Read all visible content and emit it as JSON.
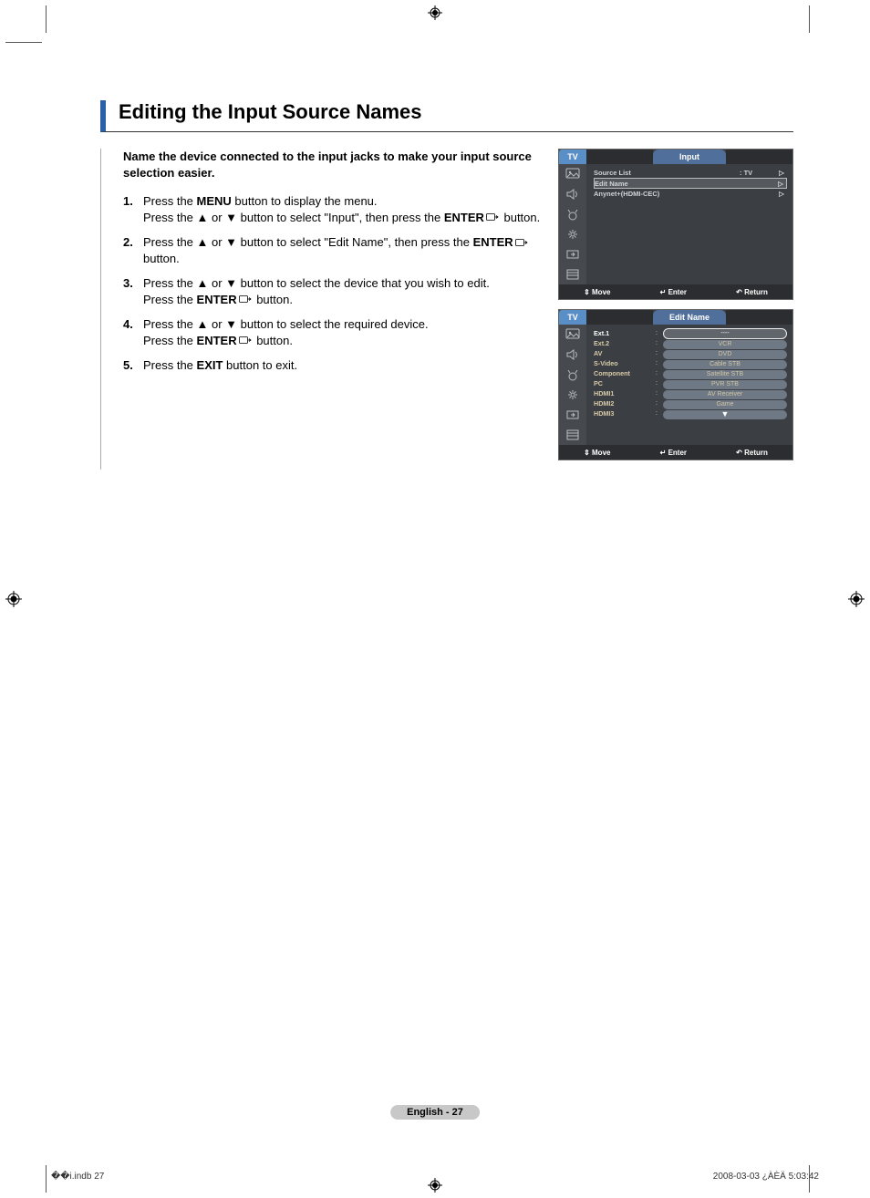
{
  "title": "Editing the Input Source Names",
  "intro": "Name the device connected to the input jacks to make your input source selection easier.",
  "steps": [
    {
      "num": "1.",
      "html": "Press the <b>MENU</b> button to display the menu.<br>Press the ▲ or ▼ button to select \"Input\", then press the <b>ENTER</b><svg class='enter-icon' width='14' height='10'><rect x='0.5' y='0.5' width='9' height='7' rx='1' fill='none' stroke='#000' stroke-width='0.8'/><path d='M9.5 4 L13 4 M11 2.5 L13 4 L11 5.5' fill='none' stroke='#000' stroke-width='0.8'/></svg> button."
    },
    {
      "num": "2.",
      "html": "Press the ▲ or ▼ button to select \"Edit Name\", then press the <b>ENTER</b><svg class='enter-icon' width='14' height='10'><rect x='0.5' y='0.5' width='9' height='7' rx='1' fill='none' stroke='#000' stroke-width='0.8'/><path d='M9.5 4 L13 4 M11 2.5 L13 4 L11 5.5' fill='none' stroke='#000' stroke-width='0.8'/></svg> button."
    },
    {
      "num": "3.",
      "html": "Press the ▲ or ▼ button to select the device that you wish to edit.<br>Press the <b>ENTER</b><svg class='enter-icon' width='14' height='10'><rect x='0.5' y='0.5' width='9' height='7' rx='1' fill='none' stroke='#000' stroke-width='0.8'/><path d='M9.5 4 L13 4 M11 2.5 L13 4 L11 5.5' fill='none' stroke='#000' stroke-width='0.8'/></svg> button."
    },
    {
      "num": "4.",
      "html": "Press the ▲ or ▼ button to select the required device.<br>Press the <b>ENTER</b><svg class='enter-icon' width='14' height='10'><rect x='0.5' y='0.5' width='9' height='7' rx='1' fill='none' stroke='#000' stroke-width='0.8'/><path d='M9.5 4 L13 4 M11 2.5 L13 4 L11 5.5' fill='none' stroke='#000' stroke-width='0.8'/></svg> button."
    },
    {
      "num": "5.",
      "html": "Press the <b>EXIT</b> button to exit."
    }
  ],
  "osd1": {
    "tab": "TV",
    "title": "Input",
    "rows": [
      {
        "label": "Source List",
        "value": ": TV",
        "arrow": "▷",
        "sel": false
      },
      {
        "label": "Edit Name",
        "value": "",
        "arrow": "▷",
        "sel": true
      },
      {
        "label": "Anynet+(HDMI-CEC)",
        "value": "",
        "arrow": "▷",
        "sel": false
      }
    ],
    "foot": {
      "move": "Move",
      "enter": "Enter",
      "return": "Return"
    }
  },
  "osd2": {
    "tab": "TV",
    "title": "Edit Name",
    "inputs": [
      "Ext.1",
      "Ext.2",
      "AV",
      "S-Video",
      "Component",
      "PC",
      "HDMI1",
      "HDMI2",
      "HDMI3"
    ],
    "options": [
      "----",
      "VCR",
      "DVD",
      "Cable STB",
      "Satellite STB",
      "PVR STB",
      "AV Receiver",
      "Game"
    ],
    "foot": {
      "move": "Move",
      "enter": "Enter",
      "return": "Return"
    }
  },
  "page_foot": "English - 27",
  "meta": {
    "left": "��i.indb   27",
    "right": "2008-03-03   ¿ÀÈÄ 5:03:42"
  },
  "foot_icons": {
    "move": "⇕",
    "enter": "↵",
    "return": "↶"
  }
}
